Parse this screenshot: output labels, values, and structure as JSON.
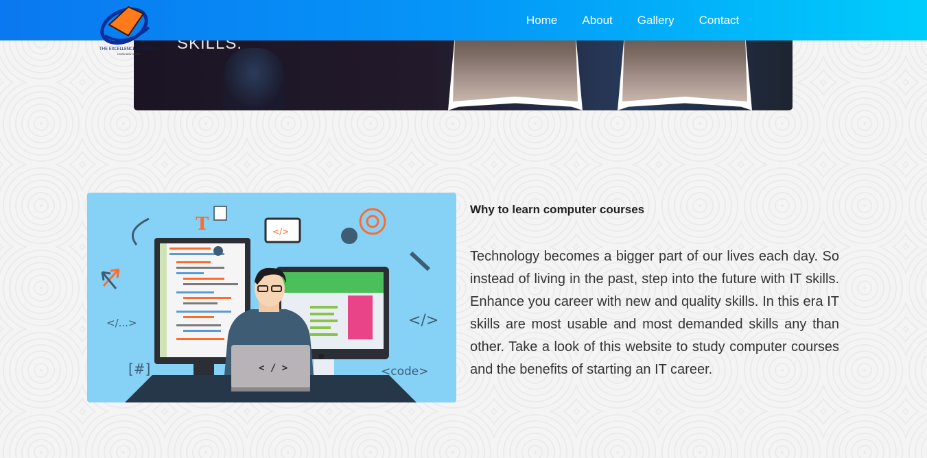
{
  "header": {
    "logo_text_top": "THE EXCELLENCE ACADEMY",
    "logo_text_bottom": "LEARN AND GROW",
    "nav": [
      "Home",
      "About",
      "Gallery",
      "Contact"
    ]
  },
  "hero": {
    "caption": "SKILLS."
  },
  "illustration": {
    "labels": [
      "T",
      "</>",
      "</...>",
      "</>",
      "[#]",
      "<code>",
      "< / >"
    ]
  },
  "section": {
    "heading": "Why to learn computer courses",
    "body": "Technology becomes a bigger part of our lives each day. So instead of living in the past, step into the future with IT skills. Enhance you career with new and quality skills. In this era IT skills are most usable and most demanded skills any than other. Take a look of this website to study computer courses and the benefits of starting an IT career."
  }
}
